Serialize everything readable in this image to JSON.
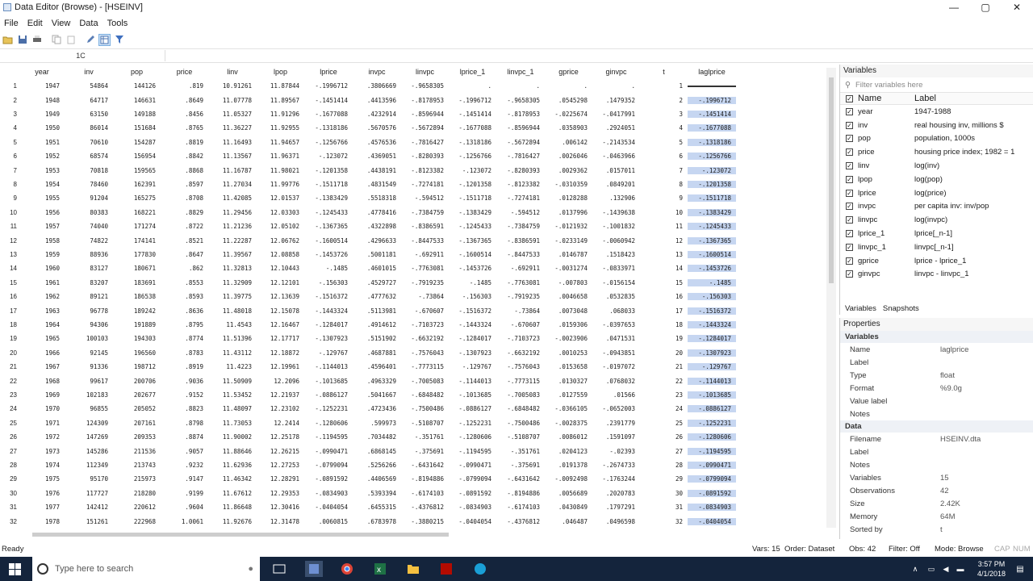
{
  "window": {
    "title": "Data Editor (Browse) - [HSEINV]",
    "min": "—",
    "max": "▢",
    "close": "✕"
  },
  "menu": [
    "File",
    "Edit",
    "View",
    "Data",
    "Tools"
  ],
  "cellbar": {
    "ref": "1C",
    "value": ""
  },
  "grid": {
    "columns": [
      "year",
      "inv",
      "pop",
      "price",
      "linv",
      "lpop",
      "lprice",
      "invpc",
      "linvpc",
      "lprice_1",
      "linvpc_1",
      "gprice",
      "ginvpc",
      "t",
      "laglprice"
    ],
    "rows": [
      [
        "1",
        "1947",
        "54864",
        "144126",
        ".819",
        "10.91261",
        "11.87844",
        "-.1996712",
        ".3806669",
        "-.9658305",
        ".",
        ".",
        ".",
        ".",
        "1",
        ""
      ],
      [
        "2",
        "1948",
        "64717",
        "146631",
        ".8649",
        "11.07778",
        "11.89567",
        "-.1451414",
        ".4413596",
        "-.8178953",
        "-.1996712",
        "-.9658305",
        ".0545298",
        ".1479352",
        "2",
        "-.1996712"
      ],
      [
        "3",
        "1949",
        "63150",
        "149188",
        ".8456",
        "11.05327",
        "11.91296",
        "-.1677088",
        ".4232914",
        "-.8596944",
        "-.1451414",
        "-.8178953",
        "-.0225674",
        "-.0417991",
        "3",
        "-.1451414"
      ],
      [
        "4",
        "1950",
        "86014",
        "151684",
        ".8765",
        "11.36227",
        "11.92955",
        "-.1318186",
        ".5670576",
        "-.5672894",
        "-.1677088",
        "-.8596944",
        ".0358903",
        ".2924051",
        "4",
        "-.1677088"
      ],
      [
        "5",
        "1951",
        "70610",
        "154287",
        ".8819",
        "11.16493",
        "11.94657",
        "-.1256766",
        ".4576536",
        "-.7816427",
        "-.1318186",
        "-.5672894",
        ".006142",
        "-.2143534",
        "5",
        "-.1318186"
      ],
      [
        "6",
        "1952",
        "68574",
        "156954",
        ".8842",
        "11.13567",
        "11.96371",
        "-.123072",
        ".4369051",
        "-.8280393",
        "-.1256766",
        "-.7816427",
        ".0026046",
        "-.0463966",
        "6",
        "-.1256766"
      ],
      [
        "7",
        "1953",
        "70818",
        "159565",
        ".8868",
        "11.16787",
        "11.98021",
        "-.1201358",
        ".4438191",
        "-.8123382",
        "-.123072",
        "-.8280393",
        ".0029362",
        ".0157011",
        "7",
        "-.123072"
      ],
      [
        "8",
        "1954",
        "78460",
        "162391",
        ".8597",
        "11.27034",
        "11.99776",
        "-.1511718",
        ".4831549",
        "-.7274181",
        "-.1201358",
        "-.8123382",
        "-.0310359",
        ".0849201",
        "8",
        "-.1201358"
      ],
      [
        "9",
        "1955",
        "91204",
        "165275",
        ".8708",
        "11.42085",
        "12.01537",
        "-.1383429",
        ".5518318",
        "-.594512",
        "-.1511718",
        "-.7274181",
        ".0128288",
        ".132906",
        "9",
        "-.1511718"
      ],
      [
        "10",
        "1956",
        "80383",
        "168221",
        ".8829",
        "11.29456",
        "12.03303",
        "-.1245433",
        ".4778416",
        "-.7384759",
        "-.1383429",
        "-.594512",
        ".0137996",
        "-.1439638",
        "10",
        "-.1383429"
      ],
      [
        "11",
        "1957",
        "74040",
        "171274",
        ".8722",
        "11.21236",
        "12.05102",
        "-.1367365",
        ".4322898",
        "-.8386591",
        "-.1245433",
        "-.7384759",
        "-.0121932",
        "-.1001832",
        "11",
        "-.1245433"
      ],
      [
        "12",
        "1958",
        "74822",
        "174141",
        ".8521",
        "11.22287",
        "12.06762",
        "-.1600514",
        ".4296633",
        "-.8447533",
        "-.1367365",
        "-.8386591",
        "-.0233149",
        "-.0060942",
        "12",
        "-.1367365"
      ],
      [
        "13",
        "1959",
        "88936",
        "177830",
        ".8647",
        "11.39567",
        "12.08858",
        "-.1453726",
        ".5001181",
        "-.692911",
        "-.1600514",
        "-.8447533",
        ".0146787",
        ".1518423",
        "13",
        "-.1600514"
      ],
      [
        "14",
        "1960",
        "83127",
        "180671",
        ".862",
        "11.32813",
        "12.10443",
        "-.1485",
        ".4601015",
        "-.7763081",
        "-.1453726",
        "-.692911",
        "-.0031274",
        "-.0833971",
        "14",
        "-.1453726"
      ],
      [
        "15",
        "1961",
        "83207",
        "183691",
        ".8553",
        "11.32909",
        "12.12101",
        "-.156303",
        ".4529727",
        "-.7919235",
        "-.1485",
        "-.7763081",
        "-.007803",
        "-.0156154",
        "15",
        "-.1485"
      ],
      [
        "16",
        "1962",
        "89121",
        "186538",
        ".8593",
        "11.39775",
        "12.13639",
        "-.1516372",
        ".4777632",
        "-.73864",
        "-.156303",
        "-.7919235",
        ".0046658",
        ".0532835",
        "16",
        "-.156303"
      ],
      [
        "17",
        "1963",
        "96778",
        "189242",
        ".8636",
        "11.48018",
        "12.15078",
        "-.1443324",
        ".5113981",
        "-.670607",
        "-.1516372",
        "-.73864",
        ".0073048",
        ".068033",
        "17",
        "-.1516372"
      ],
      [
        "18",
        "1964",
        "94306",
        "191889",
        ".8795",
        "11.4543",
        "12.16467",
        "-.1284017",
        ".4914612",
        "-.7103723",
        "-.1443324",
        "-.670607",
        ".0159306",
        "-.0397653",
        "18",
        "-.1443324"
      ],
      [
        "19",
        "1965",
        "100103",
        "194303",
        ".8774",
        "11.51396",
        "12.17717",
        "-.1307923",
        ".5151902",
        "-.6632192",
        "-.1284017",
        "-.7103723",
        "-.0023906",
        ".0471531",
        "19",
        "-.1284017"
      ],
      [
        "20",
        "1966",
        "92145",
        "196560",
        ".8783",
        "11.43112",
        "12.18872",
        "-.129767",
        ".4687881",
        "-.7576043",
        "-.1307923",
        "-.6632192",
        ".0010253",
        "-.0943851",
        "20",
        "-.1307923"
      ],
      [
        "21",
        "1967",
        "91336",
        "198712",
        ".8919",
        "11.4223",
        "12.19961",
        "-.1144013",
        ".4596401",
        "-.7773115",
        "-.129767",
        "-.7576043",
        ".0153658",
        "-.0197072",
        "21",
        "-.129767"
      ],
      [
        "22",
        "1968",
        "99617",
        "200706",
        ".9036",
        "11.50909",
        "12.2096",
        "-.1013685",
        ".4963329",
        "-.7005083",
        "-.1144013",
        "-.7773115",
        ".0130327",
        ".0768032",
        "22",
        "-.1144013"
      ],
      [
        "23",
        "1969",
        "102183",
        "202677",
        ".9152",
        "11.53452",
        "12.21937",
        "-.0886127",
        ".5041667",
        "-.6848482",
        "-.1013685",
        "-.7005083",
        ".0127559",
        ".01566",
        "23",
        "-.1013685"
      ],
      [
        "24",
        "1970",
        "96855",
        "205052",
        ".8823",
        "11.48097",
        "12.23102",
        "-.1252231",
        ".4723436",
        "-.7500486",
        "-.0886127",
        "-.6848482",
        "-.0366105",
        "-.0652003",
        "24",
        "-.0886127"
      ],
      [
        "25",
        "1971",
        "124309",
        "207161",
        ".8798",
        "11.73053",
        "12.2414",
        "-.1280606",
        ".599973",
        "-.5108707",
        "-.1252231",
        "-.7500486",
        "-.0028375",
        ".2391779",
        "25",
        "-.1252231"
      ],
      [
        "26",
        "1972",
        "147269",
        "209353",
        ".8874",
        "11.90002",
        "12.25178",
        "-.1194595",
        ".7034482",
        "-.351761",
        "-.1280606",
        "-.5108707",
        ".0086012",
        ".1591097",
        "26",
        "-.1280606"
      ],
      [
        "27",
        "1973",
        "145286",
        "211536",
        ".9057",
        "11.88646",
        "12.26215",
        "-.0990471",
        ".6868145",
        "-.375691",
        "-.1194595",
        "-.351761",
        ".0204123",
        "-.02393",
        "27",
        "-.1194595"
      ],
      [
        "28",
        "1974",
        "112349",
        "213743",
        ".9232",
        "11.62936",
        "12.27253",
        "-.0799094",
        ".5256266",
        "-.6431642",
        "-.0990471",
        "-.375691",
        ".0191378",
        "-.2674733",
        "28",
        "-.0990471"
      ],
      [
        "29",
        "1975",
        "95170",
        "215973",
        ".9147",
        "11.46342",
        "12.28291",
        "-.0891592",
        ".4406569",
        "-.8194886",
        "-.0799094",
        "-.6431642",
        "-.0092498",
        "-.1763244",
        "29",
        "-.0799094"
      ],
      [
        "30",
        "1976",
        "117727",
        "218280",
        ".9199",
        "11.67612",
        "12.29353",
        "-.0834903",
        ".5393394",
        "-.6174103",
        "-.0891592",
        "-.8194886",
        ".0056689",
        ".2020783",
        "30",
        "-.0891592"
      ],
      [
        "31",
        "1977",
        "142412",
        "220612",
        ".9604",
        "11.86648",
        "12.30416",
        "-.0404054",
        ".6455315",
        "-.4376812",
        "-.0834903",
        "-.6174103",
        ".0430849",
        ".1797291",
        "31",
        "-.0834903"
      ],
      [
        "32",
        "1978",
        "151261",
        "222968",
        "1.0061",
        "11.92676",
        "12.31478",
        ".0060815",
        ".6783978",
        "-.3880215",
        "-.0404054",
        "-.4376812",
        ".046487",
        ".0496598",
        "32",
        "-.0404054"
      ]
    ]
  },
  "variables_panel": {
    "title": "Variables",
    "filter_placeholder": "Filter variables here",
    "col_name": "Name",
    "col_label": "Label",
    "items": [
      {
        "name": "year",
        "label": "1947-1988"
      },
      {
        "name": "inv",
        "label": "real housing inv, millions $"
      },
      {
        "name": "pop",
        "label": "population, 1000s"
      },
      {
        "name": "price",
        "label": "housing price index; 1982 = 1"
      },
      {
        "name": "linv",
        "label": "log(inv)"
      },
      {
        "name": "lpop",
        "label": "log(pop)"
      },
      {
        "name": "lprice",
        "label": "log(price)"
      },
      {
        "name": "invpc",
        "label": "per capita inv: inv/pop"
      },
      {
        "name": "linvpc",
        "label": "log(invpc)"
      },
      {
        "name": "lprice_1",
        "label": "lprice[_n-1]"
      },
      {
        "name": "linvpc_1",
        "label": "linvpc[_n-1]"
      },
      {
        "name": "gprice",
        "label": "lprice - lprice_1"
      },
      {
        "name": "ginvpc",
        "label": "linvpc - linvpc_1"
      }
    ],
    "tab_variables": "Variables",
    "tab_snapshots": "Snapshots"
  },
  "properties_panel": {
    "title": "Properties",
    "sec_variables": "Variables",
    "variables": [
      {
        "k": "Name",
        "v": "laglprice"
      },
      {
        "k": "Label",
        "v": ""
      },
      {
        "k": "Type",
        "v": "float"
      },
      {
        "k": "Format",
        "v": "%9.0g"
      },
      {
        "k": "Value label",
        "v": ""
      },
      {
        "k": "Notes",
        "v": ""
      }
    ],
    "sec_data": "Data",
    "data": [
      {
        "k": "Filename",
        "v": "HSEINV.dta"
      },
      {
        "k": "Label",
        "v": ""
      },
      {
        "k": "Notes",
        "v": ""
      },
      {
        "k": "Variables",
        "v": "15"
      },
      {
        "k": "Observations",
        "v": "42"
      },
      {
        "k": "Size",
        "v": "2.42K"
      },
      {
        "k": "Memory",
        "v": "64M"
      },
      {
        "k": "Sorted by",
        "v": "t"
      }
    ]
  },
  "status": {
    "ready": "Ready",
    "vars": "Vars: 15",
    "order": "Order: Dataset",
    "obs": "Obs: 42",
    "filter": "Filter: Off",
    "mode": "Mode: Browse",
    "caps": "CAP",
    "num": "NUM"
  },
  "taskbar": {
    "search_placeholder": "Type here to search",
    "time": "3:57 PM",
    "date": "4/1/2018"
  },
  "colors": {
    "highlight": "#c6d6f1",
    "taskbar": "#14243c"
  }
}
